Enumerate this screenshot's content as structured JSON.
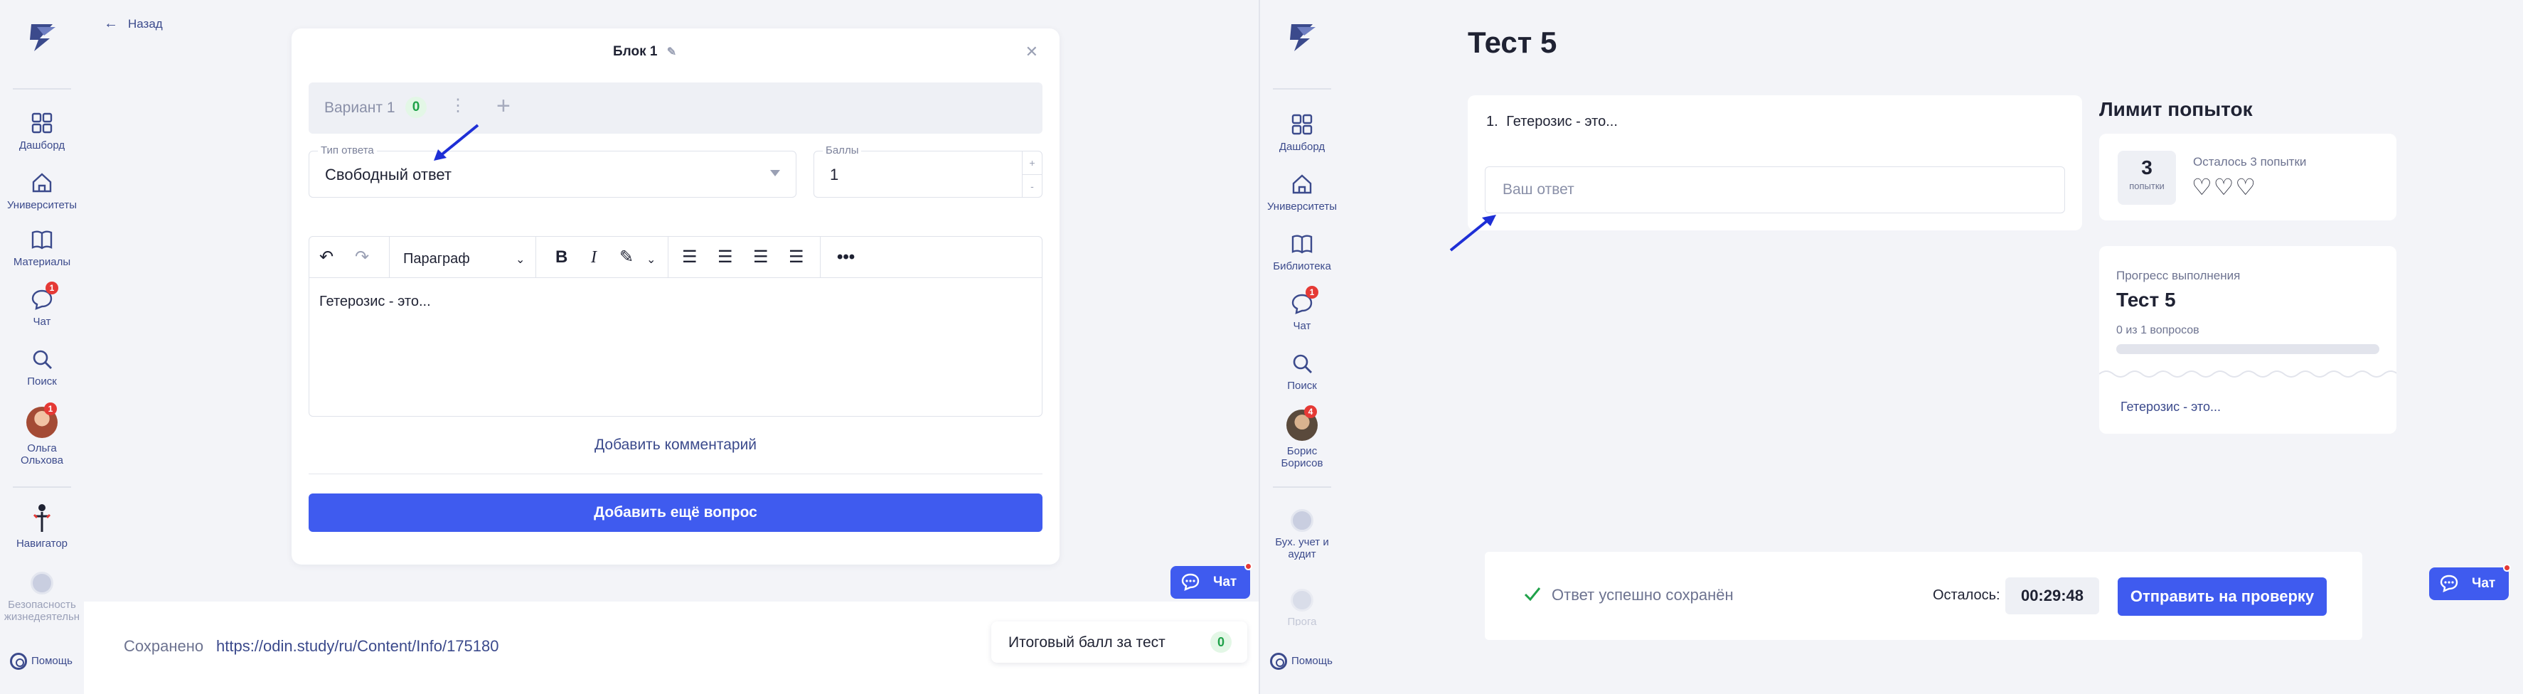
{
  "colors": {
    "accent": "#3f5bef",
    "nav_text": "#3b4a8c",
    "success": "#20a24a",
    "badge": "#e53935",
    "annotation_arrow": "#1e2fd6"
  },
  "left": {
    "sidebar": {
      "items": [
        {
          "label": "Дашборд",
          "icon": "dashboard-icon"
        },
        {
          "label": "Университеты",
          "icon": "home-icon"
        },
        {
          "label": "Материалы",
          "icon": "book-icon"
        },
        {
          "label": "Чат",
          "icon": "chat-icon",
          "badge": "1"
        },
        {
          "label": "Поиск",
          "icon": "search-icon"
        },
        {
          "label": "Ольга Ольхова",
          "icon": "avatar",
          "badge": "1"
        },
        {
          "label": "Навигатор",
          "icon": "navigator-icon"
        },
        {
          "label": "Безопасность жизнедеятельн",
          "icon": "course-icon"
        }
      ],
      "help": "Помощь"
    },
    "back": "Назад",
    "block_title": "Блок 1",
    "variant": {
      "label": "Вариант 1",
      "count": "0"
    },
    "answer_type": {
      "caption": "Тип ответа",
      "value": "Свободный ответ"
    },
    "points": {
      "caption": "Баллы",
      "value": "1"
    },
    "editor": {
      "paragraph": "Параграф",
      "text": "Гетерозис - это..."
    },
    "add_comment": "Добавить комментарий",
    "add_question": "Добавить ещё вопрос",
    "chat_button": "Чат",
    "footer": {
      "saved": "Сохранено",
      "url": "https://odin.study/ru/Content/Info/175180",
      "total_label": "Итоговый балл за тест",
      "total_value": "0"
    }
  },
  "right": {
    "sidebar": {
      "items": [
        {
          "label": "Дашборд",
          "icon": "dashboard-icon"
        },
        {
          "label": "Университеты",
          "icon": "home-icon"
        },
        {
          "label": "Библиотека",
          "icon": "book-icon"
        },
        {
          "label": "Чат",
          "icon": "chat-icon",
          "badge": "1"
        },
        {
          "label": "Поиск",
          "icon": "search-icon"
        },
        {
          "label": "Борис Борисов",
          "icon": "avatar",
          "badge": "4"
        },
        {
          "label": "Бух. учет и аудит",
          "icon": "course-icon"
        },
        {
          "label": "Прога",
          "icon": "course-icon"
        }
      ],
      "help": "Помощь"
    },
    "test_title": "Тест 5",
    "question": {
      "number": "1.",
      "text": "Гетерозис - это...",
      "placeholder": "Ваш ответ"
    },
    "attempts": {
      "section_title": "Лимит попыток",
      "count": "3",
      "count_label": "попытки",
      "remaining": "Осталось 3 попытки",
      "hearts": 3
    },
    "progress": {
      "caption": "Прогресс выполнения",
      "title": "Тест 5",
      "count_text": "0 из 1 вопросов",
      "fraction": 0,
      "question_link": "Гетерозис - это..."
    },
    "footer": {
      "saved_text": "Ответ успешно сохранён",
      "remaining_label": "Осталось:",
      "timer": "00:29:48",
      "submit": "Отправить на проверку"
    },
    "chat_button": "Чат"
  }
}
